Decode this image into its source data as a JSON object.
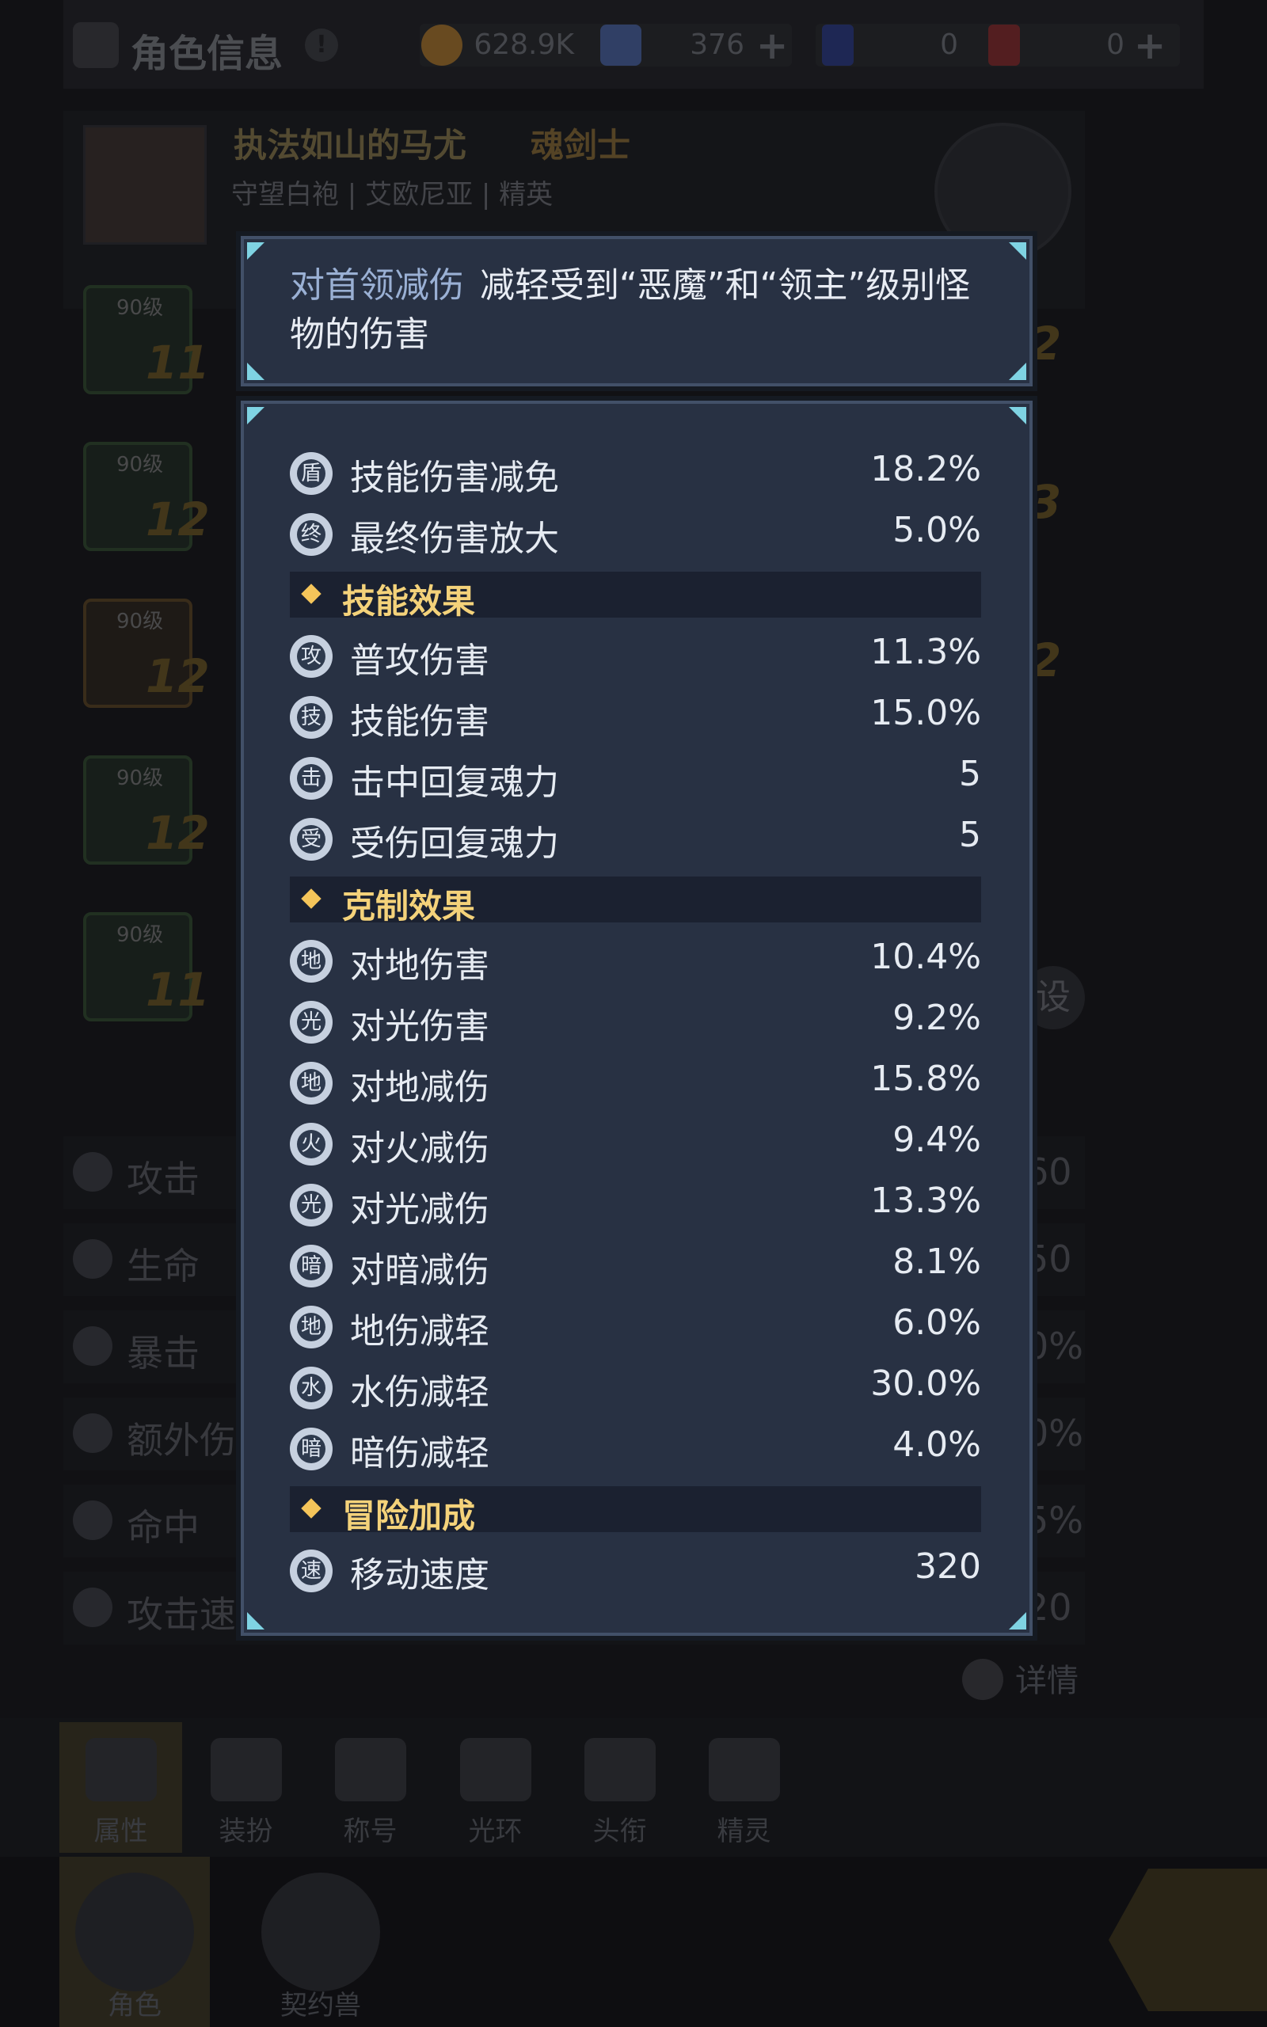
{
  "background": {
    "title": "角色信息",
    "help_glyph": "!",
    "currencies": [
      {
        "icon": "gold-coin-icon",
        "value": "628.9K",
        "color": "#b07a2a"
      },
      {
        "icon": "crystal-icon",
        "value": "376",
        "color": "#4a66a8"
      },
      {
        "icon": "blue-card-icon",
        "value": "0",
        "color": "#2a3a8a"
      },
      {
        "icon": "red-card-icon",
        "value": "0",
        "color": "#8a2a2a"
      }
    ],
    "plus": "+",
    "character": {
      "name": "执法如山的马尤",
      "class": "魂剑士",
      "guild": "守望白袍",
      "region": "艾欧尼亚",
      "rank": "精英"
    },
    "equipment_slots": [
      {
        "level": "90级",
        "enhance": "11",
        "tone": "green"
      },
      {
        "level": "90级",
        "enhance": "12",
        "tone": "green"
      },
      {
        "level": "90级",
        "enhance": "12",
        "tone": "orange"
      },
      {
        "level": "90级",
        "enhance": "12",
        "tone": "green"
      },
      {
        "level": "90级",
        "enhance": "11",
        "tone": "green"
      }
    ],
    "right_slot_numbers": [
      "2",
      "3",
      "2"
    ],
    "side_button_label": "设",
    "stats": [
      {
        "icon": "sword-icon",
        "label": "攻击",
        "value": "60"
      },
      {
        "icon": "heart-icon",
        "label": "生命",
        "value": "50"
      },
      {
        "icon": "crit-icon",
        "label": "暴击",
        "value": "0%"
      },
      {
        "icon": "extra-damage-icon",
        "label": "额外伤",
        "value": "0%"
      },
      {
        "icon": "target-icon",
        "label": "命中",
        "value": "5%"
      },
      {
        "icon": "attack-speed-icon",
        "label": "攻击速",
        "value": "20"
      }
    ],
    "detail_label": "详情",
    "tabs": [
      {
        "icon": "person-icon",
        "label": "属性",
        "active": true
      },
      {
        "icon": "hanger-icon",
        "label": "装扮",
        "active": false
      },
      {
        "icon": "crown-icon",
        "label": "称号",
        "active": false
      },
      {
        "icon": "halo-icon",
        "label": "光环",
        "active": false
      },
      {
        "icon": "headgear-icon",
        "label": "头衔",
        "active": false
      },
      {
        "icon": "fairy-icon",
        "label": "精灵",
        "active": false
      }
    ],
    "bottom_tabs": [
      {
        "icon": "hood-icon",
        "label": "角色",
        "active": true
      },
      {
        "icon": "paw-icon",
        "label": "契约兽",
        "active": false
      }
    ]
  },
  "tooltip": {
    "header_key": "对首领减伤",
    "header_desc": "减轻受到“恶魔”和“领主”级别怪物的伤害",
    "top_rows": [
      {
        "icon": "skill-damage-reduction-icon",
        "glyph": "盾",
        "label": "技能伤害减免",
        "value": "18.2%"
      },
      {
        "icon": "final-damage-icon",
        "glyph": "终",
        "label": "最终伤害放大",
        "value": "5.0%"
      }
    ],
    "sections": [
      {
        "title": "技能效果",
        "rows": [
          {
            "icon": "normal-attack-icon",
            "glyph": "攻",
            "label": "普攻伤害",
            "value": "11.3%"
          },
          {
            "icon": "skill-damage-icon",
            "glyph": "技",
            "label": "技能伤害",
            "value": "15.0%"
          },
          {
            "icon": "hit-recover-icon",
            "glyph": "击",
            "label": "击中回复魂力",
            "value": "5"
          },
          {
            "icon": "hurt-recover-icon",
            "glyph": "受",
            "label": "受伤回复魂力",
            "value": "5"
          }
        ]
      },
      {
        "title": "克制效果",
        "rows": [
          {
            "icon": "earth-damage-icon",
            "glyph": "地",
            "label": "对地伤害",
            "value": "10.4%"
          },
          {
            "icon": "light-damage-icon",
            "glyph": "光",
            "label": "对光伤害",
            "value": "9.2%"
          },
          {
            "icon": "earth-resist-icon",
            "glyph": "地",
            "label": "对地减伤",
            "value": "15.8%"
          },
          {
            "icon": "fire-resist-icon",
            "glyph": "火",
            "label": "对火减伤",
            "value": "9.4%"
          },
          {
            "icon": "light-resist-icon",
            "glyph": "光",
            "label": "对光减伤",
            "value": "13.3%"
          },
          {
            "icon": "dark-resist-icon",
            "glyph": "暗",
            "label": "对暗减伤",
            "value": "8.1%"
          },
          {
            "icon": "earth-reduce-icon",
            "glyph": "地",
            "label": "地伤减轻",
            "value": "6.0%"
          },
          {
            "icon": "water-reduce-icon",
            "glyph": "水",
            "label": "水伤减轻",
            "value": "30.0%"
          },
          {
            "icon": "dark-reduce-icon",
            "glyph": "暗",
            "label": "暗伤减轻",
            "value": "4.0%"
          }
        ]
      },
      {
        "title": "冒险加成",
        "rows": [
          {
            "icon": "move-speed-icon",
            "glyph": "速",
            "label": "移动速度",
            "value": "320"
          }
        ]
      }
    ]
  }
}
